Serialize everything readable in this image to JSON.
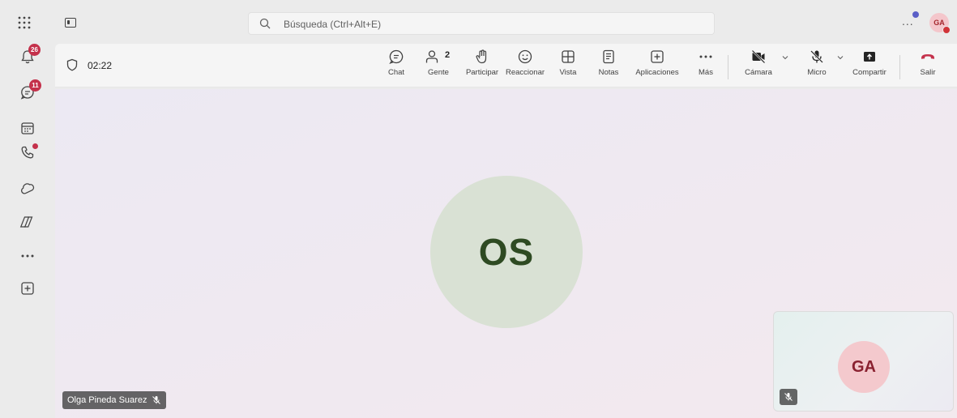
{
  "topbar": {
    "apps_icon": "grid-dots-icon",
    "panel_icon": "panel-toggle-icon",
    "search_placeholder": "Búsqueda (Ctrl+Alt+E)",
    "more_label": "...",
    "avatar_initials": "GA",
    "status_color": "#d13438",
    "accent_color": "#5b5fc7"
  },
  "rail": {
    "items": [
      {
        "name": "activity",
        "icon": "bell-icon",
        "badge": "26"
      },
      {
        "name": "chat",
        "icon": "chat-icon",
        "badge": "11"
      },
      {
        "name": "calendar",
        "icon": "calendar-icon"
      },
      {
        "name": "calls",
        "icon": "phone-icon",
        "dot": true
      },
      {
        "name": "onedrive",
        "icon": "cloud-icon"
      },
      {
        "name": "copilot",
        "icon": "copilot-icon"
      },
      {
        "name": "more",
        "icon": "more-icon"
      },
      {
        "name": "apps",
        "icon": "add-app-icon"
      }
    ]
  },
  "meeting": {
    "timer": "02:22",
    "toolbar": {
      "chat": "Chat",
      "people": "Gente",
      "people_count": "2",
      "raise": "Participar",
      "react": "Reaccionar",
      "view": "Vista",
      "notes": "Notas",
      "apps": "Aplicaciones",
      "more": "Más",
      "camera": "Cámara",
      "mic": "Micro",
      "share": "Compartir",
      "leave": "Salir"
    },
    "leave_color": "#c4314b"
  },
  "stage": {
    "main_initials": "OS",
    "main_name": "Olga Pineda Suarez",
    "self_initials": "GA"
  }
}
